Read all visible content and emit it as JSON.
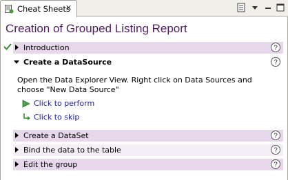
{
  "tab": {
    "label": "Cheat Sheets",
    "close": "✕"
  },
  "title": "Creation of Grouped Listing Report",
  "items": [
    {
      "label": "Introduction"
    },
    {
      "label": "Create a DataSource"
    },
    {
      "label": "Create a DataSet"
    },
    {
      "label": "Bind the data to the table"
    },
    {
      "label": "Edit the group"
    }
  ],
  "step_description": "Open the Data Explorer View. Right click on Data Sources and choose \"New Data Source\"",
  "actions": {
    "perform": "Click to perform",
    "skip": "Click to skip"
  },
  "colors": {
    "title": "#4f1f5f",
    "section_tint": "#e6d7eb",
    "link": "#1f1f99"
  }
}
